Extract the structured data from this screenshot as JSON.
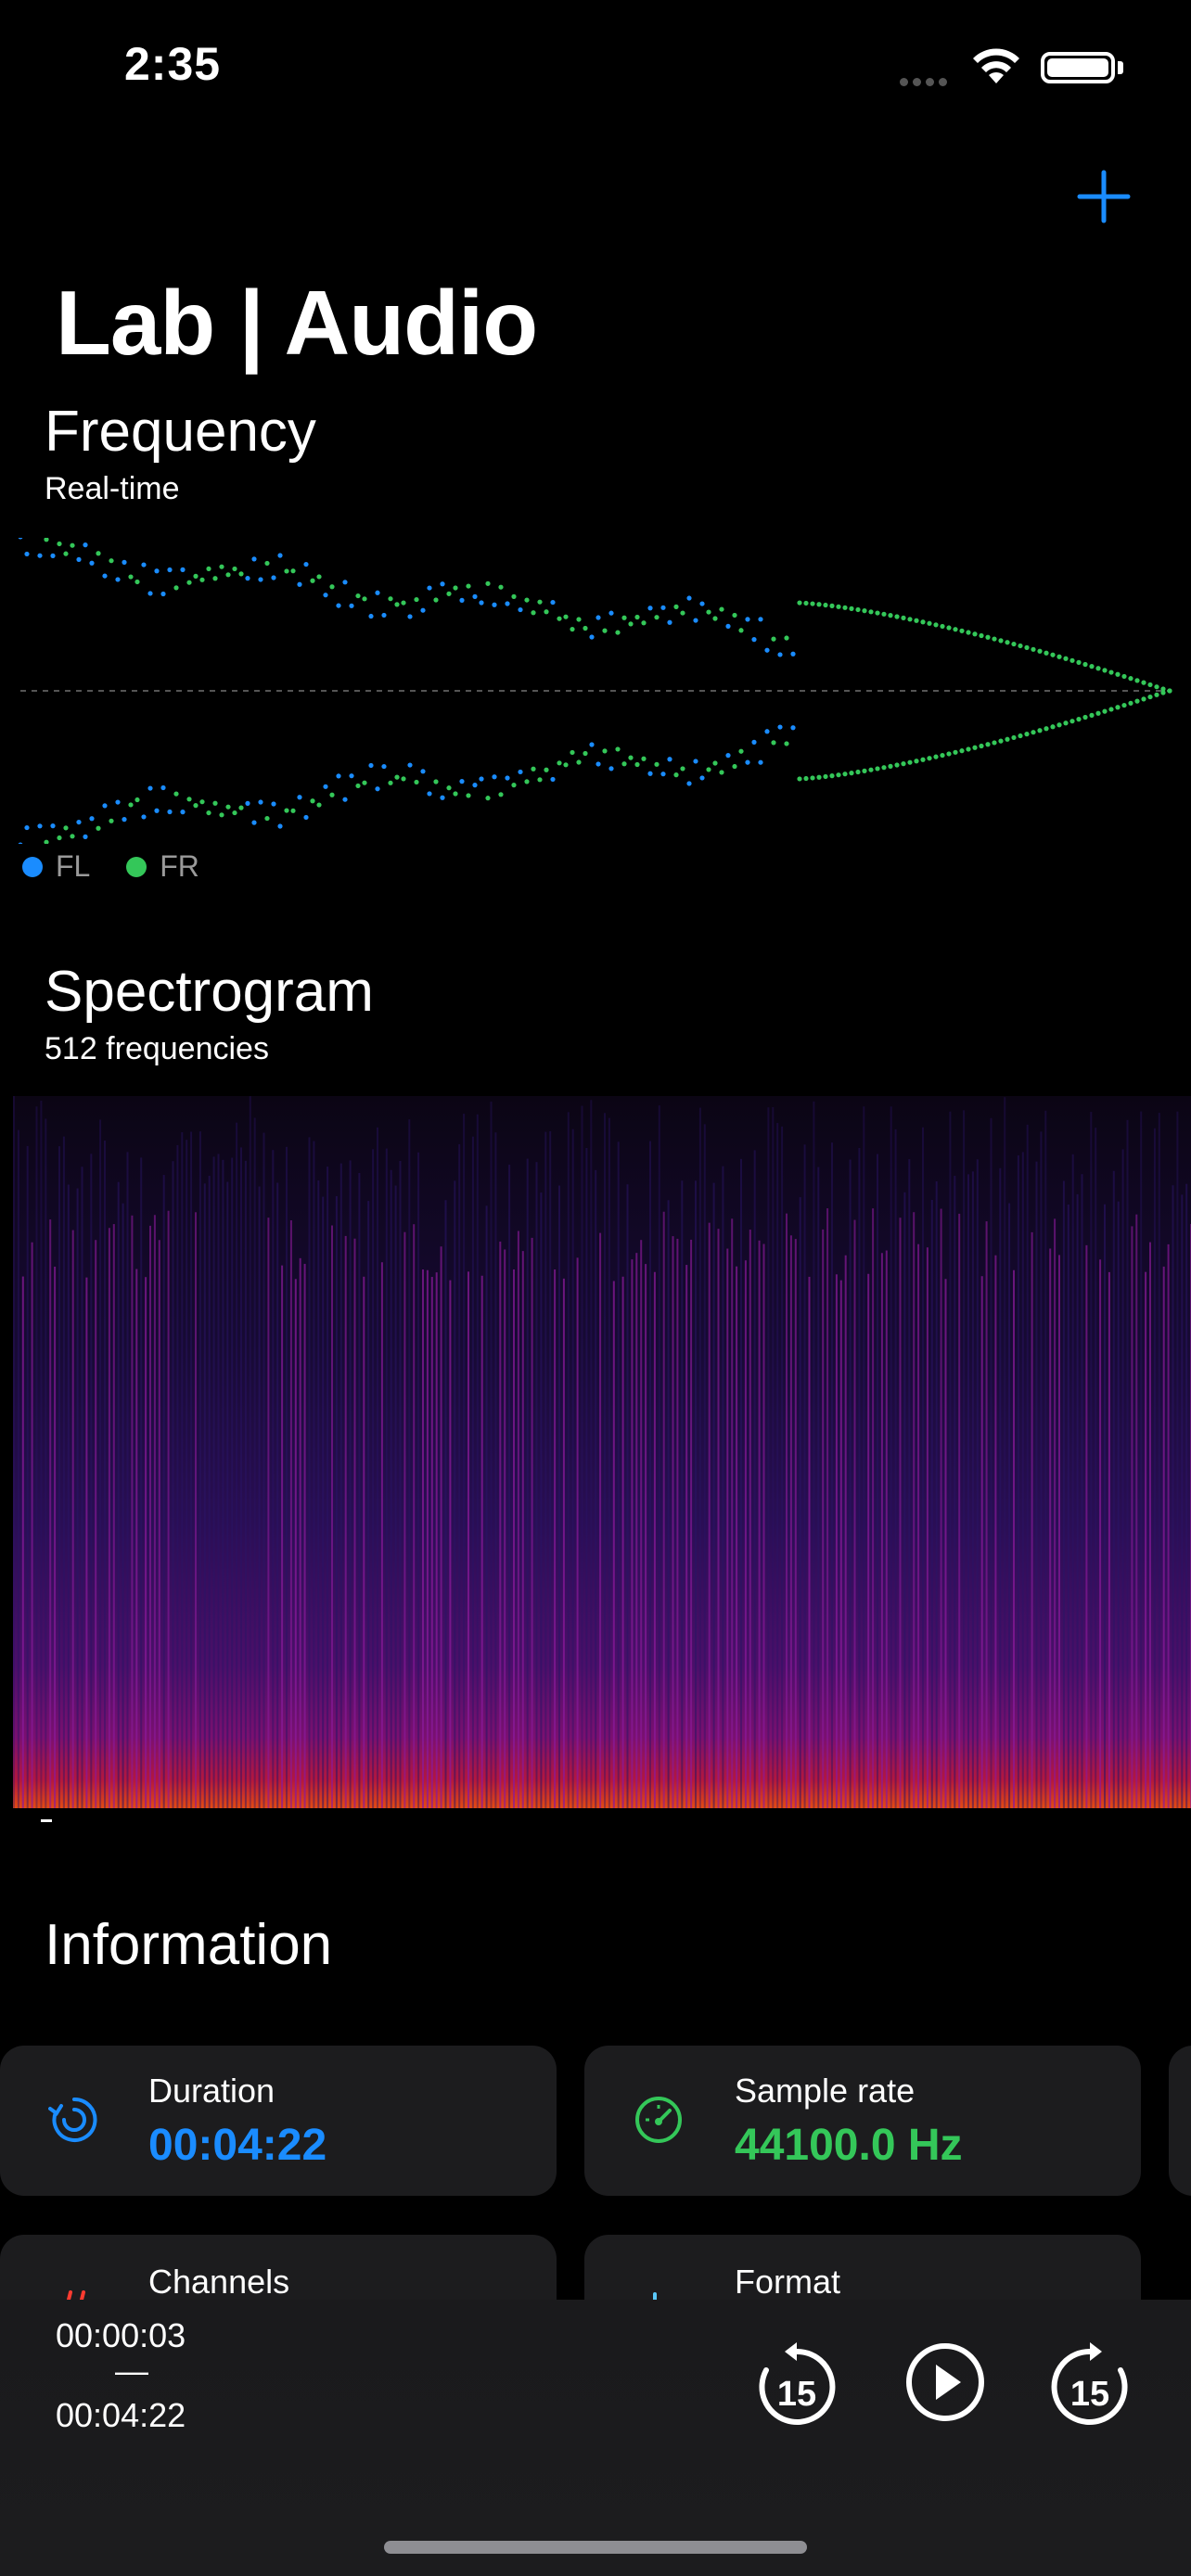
{
  "status_bar": {
    "time": "2:35"
  },
  "header": {
    "title": "Lab | Audio",
    "add_icon": "plus-icon"
  },
  "frequency": {
    "title": "Frequency",
    "subtitle": "Real-time",
    "legend": [
      {
        "label": "FL",
        "color": "#1a8cff"
      },
      {
        "label": "FR",
        "color": "#34c759"
      }
    ]
  },
  "spectrogram": {
    "title": "Spectrogram",
    "subtitle": "512 frequencies"
  },
  "information": {
    "title": "Information",
    "cards": [
      {
        "label": "Duration",
        "value": "00:04:22",
        "icon": "clock-arrow-icon",
        "color": "#1a8cff"
      },
      {
        "label": "Sample rate",
        "value": "44100.0 Hz",
        "icon": "gauge-icon",
        "color": "#34c759"
      },
      {
        "label": "Channels",
        "value": "",
        "icon": "channels-icon",
        "color": "#ff3b30"
      },
      {
        "label": "Format",
        "value": "",
        "icon": "waveform-icon",
        "color": "#5ac8fa"
      }
    ]
  },
  "player": {
    "current_time": "00:00:03",
    "separator": "—",
    "total_time": "00:04:22",
    "skip_back_label": "15",
    "skip_forward_label": "15"
  }
}
